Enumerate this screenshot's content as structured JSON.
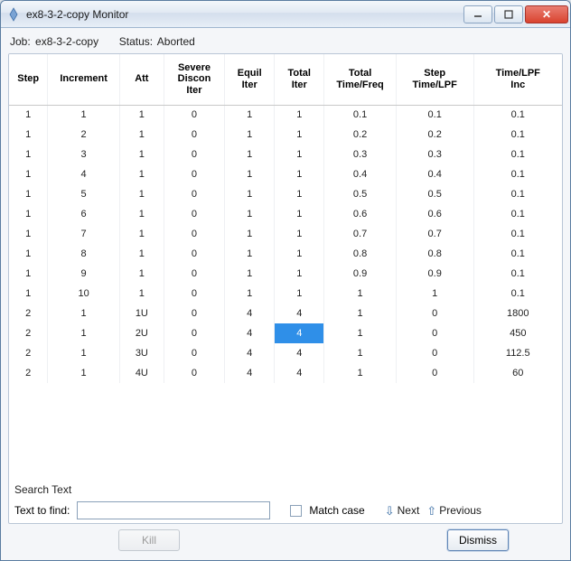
{
  "window": {
    "title": "ex8-3-2-copy Monitor"
  },
  "job": {
    "job_label": "Job:",
    "job_value": "ex8-3-2-copy",
    "status_label": "Status:",
    "status_value": "Aborted"
  },
  "table": {
    "headers": [
      "Step",
      "Increment",
      "Att",
      "Severe\nDiscon\nIter",
      "Equil\nIter",
      "Total\nIter",
      "Total\nTime/Freq",
      "Step\nTime/LPF",
      "Time/LPF\nInc"
    ],
    "rows": [
      [
        "1",
        "1",
        "1",
        "0",
        "1",
        "1",
        "0.1",
        "0.1",
        "0.1"
      ],
      [
        "1",
        "2",
        "1",
        "0",
        "1",
        "1",
        "0.2",
        "0.2",
        "0.1"
      ],
      [
        "1",
        "3",
        "1",
        "0",
        "1",
        "1",
        "0.3",
        "0.3",
        "0.1"
      ],
      [
        "1",
        "4",
        "1",
        "0",
        "1",
        "1",
        "0.4",
        "0.4",
        "0.1"
      ],
      [
        "1",
        "5",
        "1",
        "0",
        "1",
        "1",
        "0.5",
        "0.5",
        "0.1"
      ],
      [
        "1",
        "6",
        "1",
        "0",
        "1",
        "1",
        "0.6",
        "0.6",
        "0.1"
      ],
      [
        "1",
        "7",
        "1",
        "0",
        "1",
        "1",
        "0.7",
        "0.7",
        "0.1"
      ],
      [
        "1",
        "8",
        "1",
        "0",
        "1",
        "1",
        "0.8",
        "0.8",
        "0.1"
      ],
      [
        "1",
        "9",
        "1",
        "0",
        "1",
        "1",
        "0.9",
        "0.9",
        "0.1"
      ],
      [
        "1",
        "10",
        "1",
        "0",
        "1",
        "1",
        "1",
        "1",
        "0.1"
      ],
      [
        "2",
        "1",
        "1U",
        "0",
        "4",
        "4",
        "1",
        "0",
        "1800"
      ],
      [
        "2",
        "1",
        "2U",
        "0",
        "4",
        "4",
        "1",
        "0",
        "450"
      ],
      [
        "2",
        "1",
        "3U",
        "0",
        "4",
        "4",
        "1",
        "0",
        "112.5"
      ],
      [
        "2",
        "1",
        "4U",
        "0",
        "4",
        "4",
        "1",
        "0",
        "60"
      ]
    ],
    "selected": {
      "row": 11,
      "col": 5
    }
  },
  "search": {
    "section_label": "Search Text",
    "find_label": "Text to find:",
    "find_value": "",
    "match_case_label": "Match case",
    "next_label": "Next",
    "prev_label": "Previous"
  },
  "buttons": {
    "kill": "Kill",
    "dismiss": "Dismiss"
  }
}
